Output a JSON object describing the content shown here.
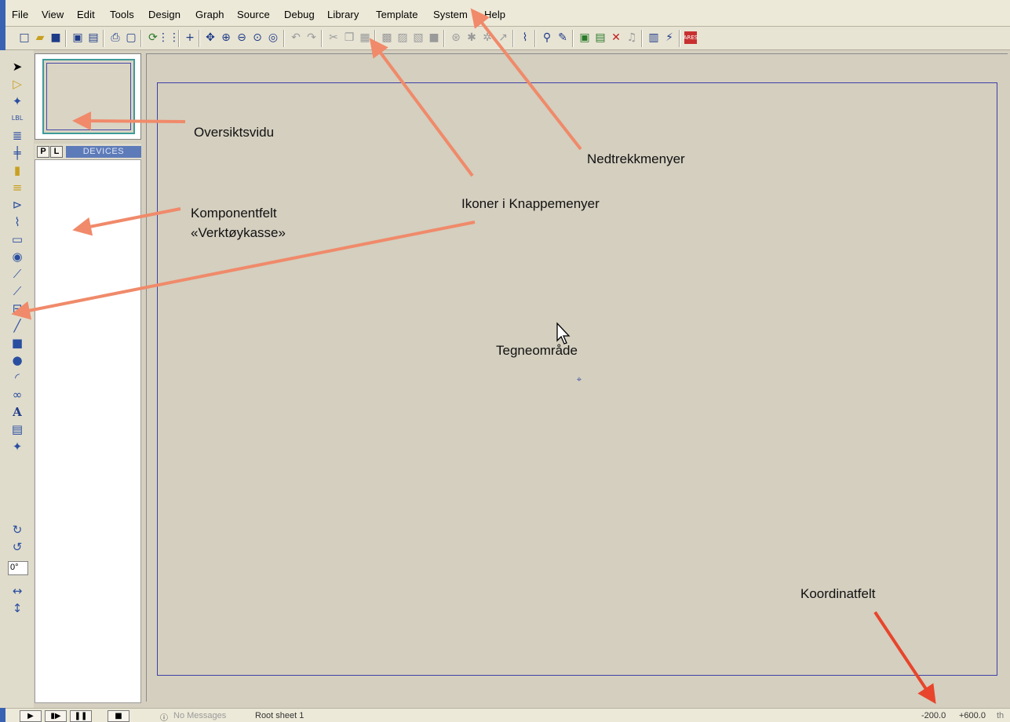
{
  "menu": [
    "File",
    "View",
    "Edit",
    "Tools",
    "Design",
    "Graph",
    "Source",
    "Debug",
    "Library",
    "Template",
    "System",
    "Help"
  ],
  "toolbar_icons": [
    "new-file-icon",
    "open-folder-icon",
    "save-icon",
    "import-icon",
    "export-icon",
    "print-icon",
    "print-area-icon",
    "refresh-icon",
    "grid-icon",
    "origin-icon",
    "pan-icon",
    "zoom-in-icon",
    "zoom-out-icon",
    "zoom-all-icon",
    "zoom-area-icon",
    "undo-icon",
    "redo-icon",
    "cut-icon",
    "copy-icon",
    "paste-icon",
    "block-copy-icon",
    "block-move-icon",
    "block-rotate-icon",
    "block-delete-icon",
    "pick-device-icon",
    "make-device-icon",
    "packaging-icon",
    "decompose-icon",
    "wire-autorouter-icon",
    "search-tag-icon",
    "property-assign-icon",
    "design-explorer-icon",
    "new-sheet-icon",
    "remove-sheet-icon",
    "goto-sheet-icon",
    "bom-icon",
    "electrical-rule-icon",
    "ares-icon"
  ],
  "tool_icons": [
    "select-icon",
    "component-icon",
    "junction-icon",
    "wire-label-icon",
    "text-script-icon",
    "buses-icon",
    "subcircuit-icon",
    "terminals-icon",
    "device-pins-icon",
    "graph-icon",
    "tape-recorder-icon",
    "generator-icon",
    "voltage-probe-icon",
    "current-probe-icon",
    "virtual-instruments-icon",
    "line-icon",
    "box-icon",
    "circle-icon",
    "arc-icon",
    "path-icon",
    "text-icon",
    "symbol-icon",
    "marker-icon",
    "rotate-cw-icon",
    "rotate-ccw-icon",
    "mirror-x-icon",
    "mirror-y-icon"
  ],
  "rotation_value": "0°",
  "panel": {
    "tab_p": "P",
    "tab_l": "L",
    "devices_label": "DEVICES"
  },
  "status": {
    "messages": "No Messages",
    "sheet": "Root sheet 1",
    "coord_x": "-200.0",
    "coord_y": "+600.0",
    "unit": "th"
  },
  "annotations": {
    "overview": "Oversiktsvidu",
    "dropdown_menus": "Nedtrekkmenyer",
    "toolbar_icons": "Ikoner i Knappemenyer",
    "component_field_1": "Komponentfelt",
    "component_field_2": "«Verktøykasse»",
    "drawing_area": "Tegneområde",
    "coordinate_field": "Koordinatfelt"
  },
  "colors": {
    "annotation_arrow": "#f08a6a",
    "annotation_arrow_dark": "#e8452c",
    "sheet_border": "#3f3fa8",
    "canvas_bg": "#d4cfbf"
  }
}
